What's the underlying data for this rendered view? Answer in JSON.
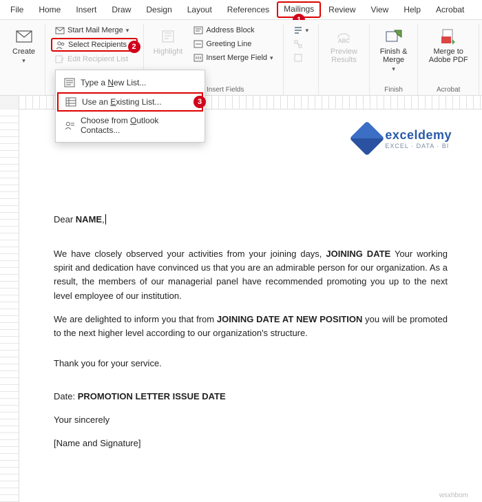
{
  "menubar": {
    "items": [
      "File",
      "Home",
      "Insert",
      "Draw",
      "Design",
      "Layout",
      "References",
      "Mailings",
      "Review",
      "View",
      "Help",
      "Acrobat"
    ],
    "active_index": 7
  },
  "callouts": {
    "one": "1",
    "two": "2",
    "three": "3"
  },
  "ribbon": {
    "create": {
      "label": "Create",
      "group": ""
    },
    "start_merge": {
      "start_mail_merge": "Start Mail Merge",
      "select_recipients": "Select Recipients",
      "edit_recipient": "Edit Recipient List"
    },
    "highlight": "Highlight",
    "write_fields": {
      "address_block": "Address Block",
      "greeting_line": "Greeting Line",
      "insert_merge_field": "Insert Merge Field",
      "group_label": "Write & Insert Fields"
    },
    "preview": {
      "label": "Preview Results",
      "abc": "ABC"
    },
    "finish": {
      "label": "Finish & Merge",
      "group": "Finish"
    },
    "adobe": {
      "label": "Merge to Adobe PDF",
      "group": "Acrobat"
    }
  },
  "dropdown": {
    "type_new_list": "Type a New List...",
    "use_existing": "Use an Existing List...",
    "outlook_contacts": "Choose from Outlook Contacts..."
  },
  "logo": {
    "title": "exceldemy",
    "sub": "EXCEL · DATA · BI"
  },
  "document": {
    "dear": "Dear ",
    "name": "NAME",
    "comma": ",",
    "p1a": "We have closely observed your activities from your joining days, ",
    "p1b": "JOINING DATE",
    "p1c": " Your working spirit and dedication have convinced us that you are an admirable person for our organization. As a result, the members of our managerial panel have recommended promoting you up to the next level employee of our institution.",
    "p2a": "We are delighted to inform you that from ",
    "p2b": "JOINING DATE AT NEW POSITION",
    "p2c": " you will be promoted to the next higher level according to our organization's structure.",
    "thanks": "Thank you for your service.",
    "date_label": "Date: ",
    "date_value": "PROMOTION LETTER ISSUE DATE",
    "sincerely": "Your sincerely",
    "sig_name": "[Name and Signature]"
  },
  "watermark": "wsxhbom"
}
